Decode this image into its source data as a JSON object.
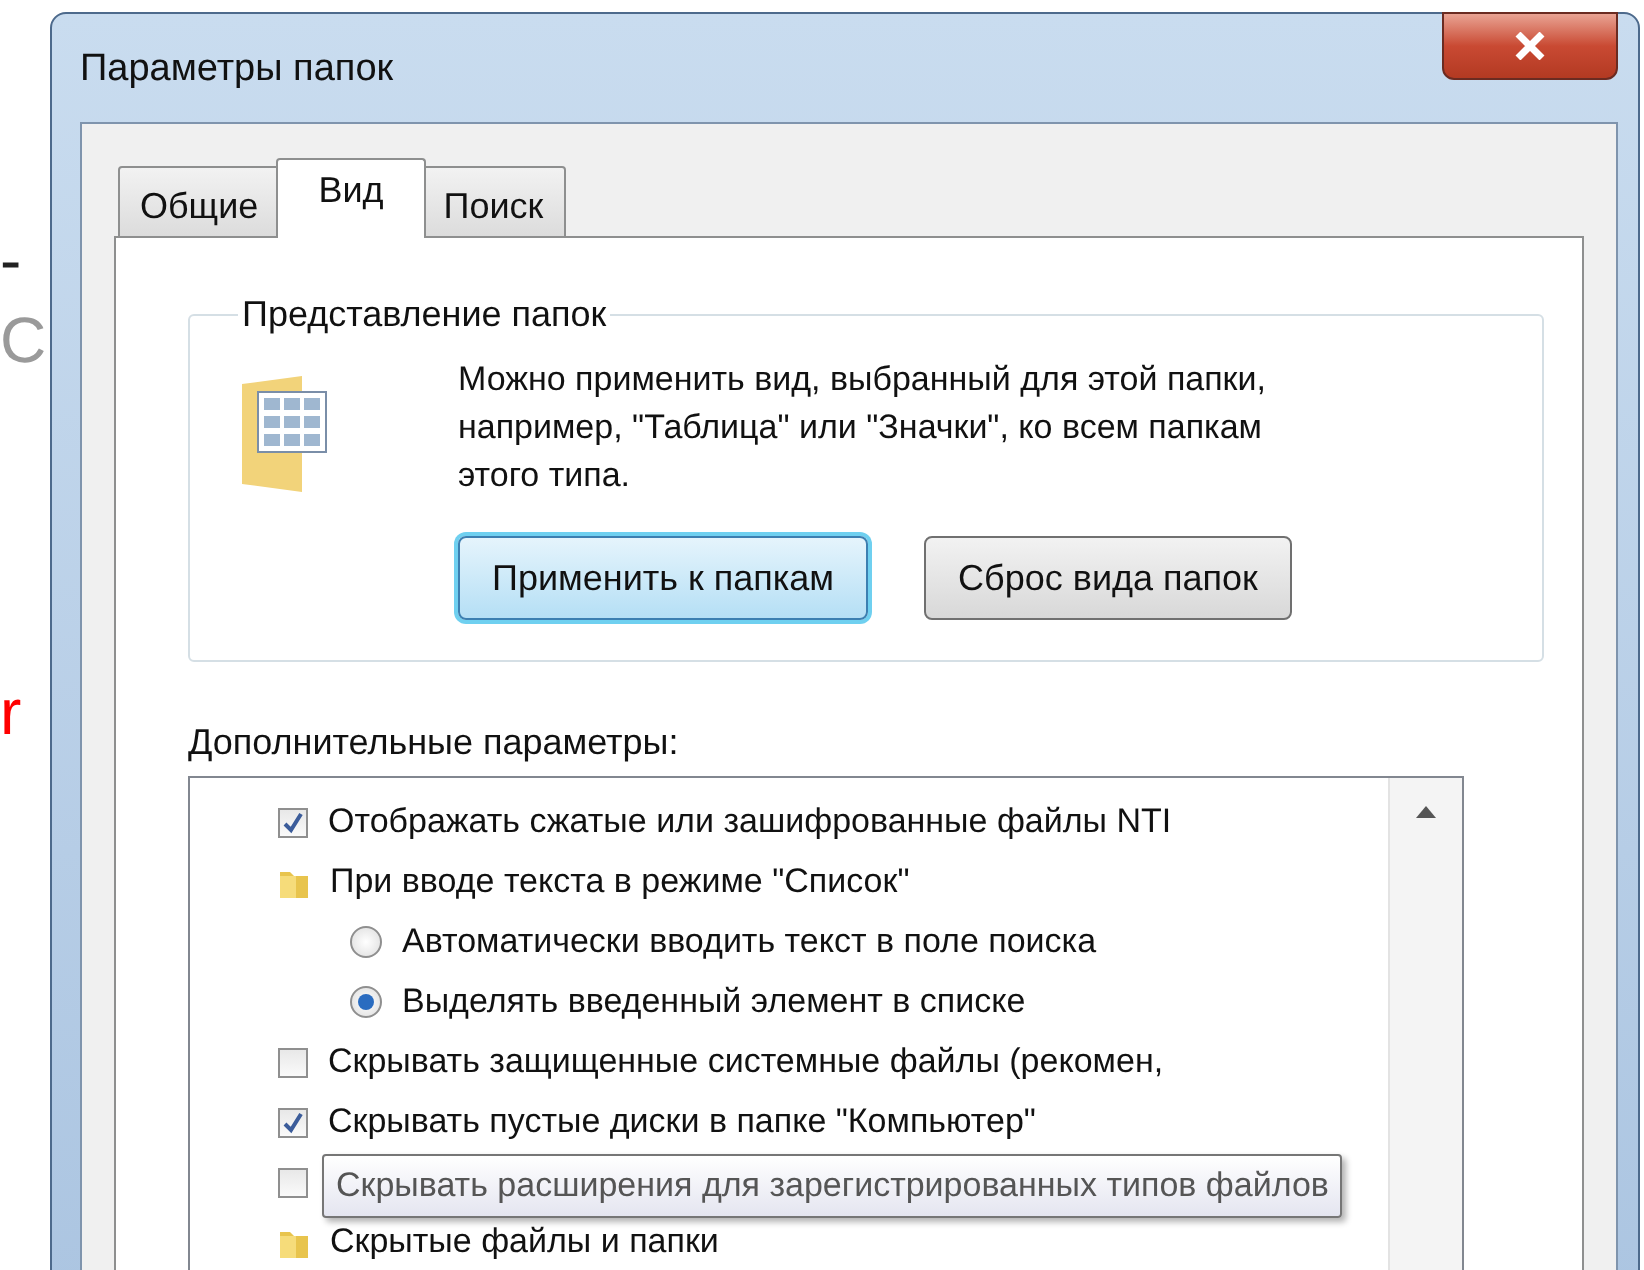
{
  "background_fragments": [
    {
      "text": "-",
      "color": "#222222"
    },
    {
      "text": "С",
      "color": "#9a9a9a"
    },
    {
      "text": "r",
      "color": "#ff0000"
    }
  ],
  "window": {
    "title": "Параметры папок"
  },
  "tabs": [
    {
      "label": "Общие",
      "selected": false
    },
    {
      "label": "Вид",
      "selected": true
    },
    {
      "label": "Поиск",
      "selected": false
    }
  ],
  "folder_views": {
    "title": "Представление папок",
    "description": "Можно применить вид, выбранный для этой папки, например, \"Таблица\" или \"Значки\", ко всем папкам этого типа.",
    "buttons": [
      {
        "label": "Применить к папкам",
        "focused": true
      },
      {
        "label": "Сброс вида папок",
        "focused": false
      }
    ]
  },
  "advanced": {
    "label": "Дополнительные параметры:",
    "items": [
      {
        "kind": "checkbox",
        "label": "Отображать сжатые или зашифрованные файлы NTI",
        "checked": true
      },
      {
        "kind": "folder",
        "label": "При вводе текста в режиме \"Список\"",
        "children": [
          {
            "kind": "radio",
            "label": "Автоматически вводить текст в поле поиска",
            "selected": false
          },
          {
            "kind": "radio",
            "label": "Выделять введенный элемент в списке",
            "selected": true
          }
        ]
      },
      {
        "kind": "checkbox",
        "label": "Скрывать защищенные системные файлы (рекомен,",
        "checked": false
      },
      {
        "kind": "checkbox",
        "label": "Скрывать пустые диски в папке \"Компьютер\"",
        "checked": true
      },
      {
        "kind": "checkbox",
        "checked": false
      },
      {
        "kind": "folder",
        "label": "Скрытые файлы и папки"
      }
    ],
    "tooltip": "Скрывать расширения для зарегистрированных типов файлов"
  }
}
